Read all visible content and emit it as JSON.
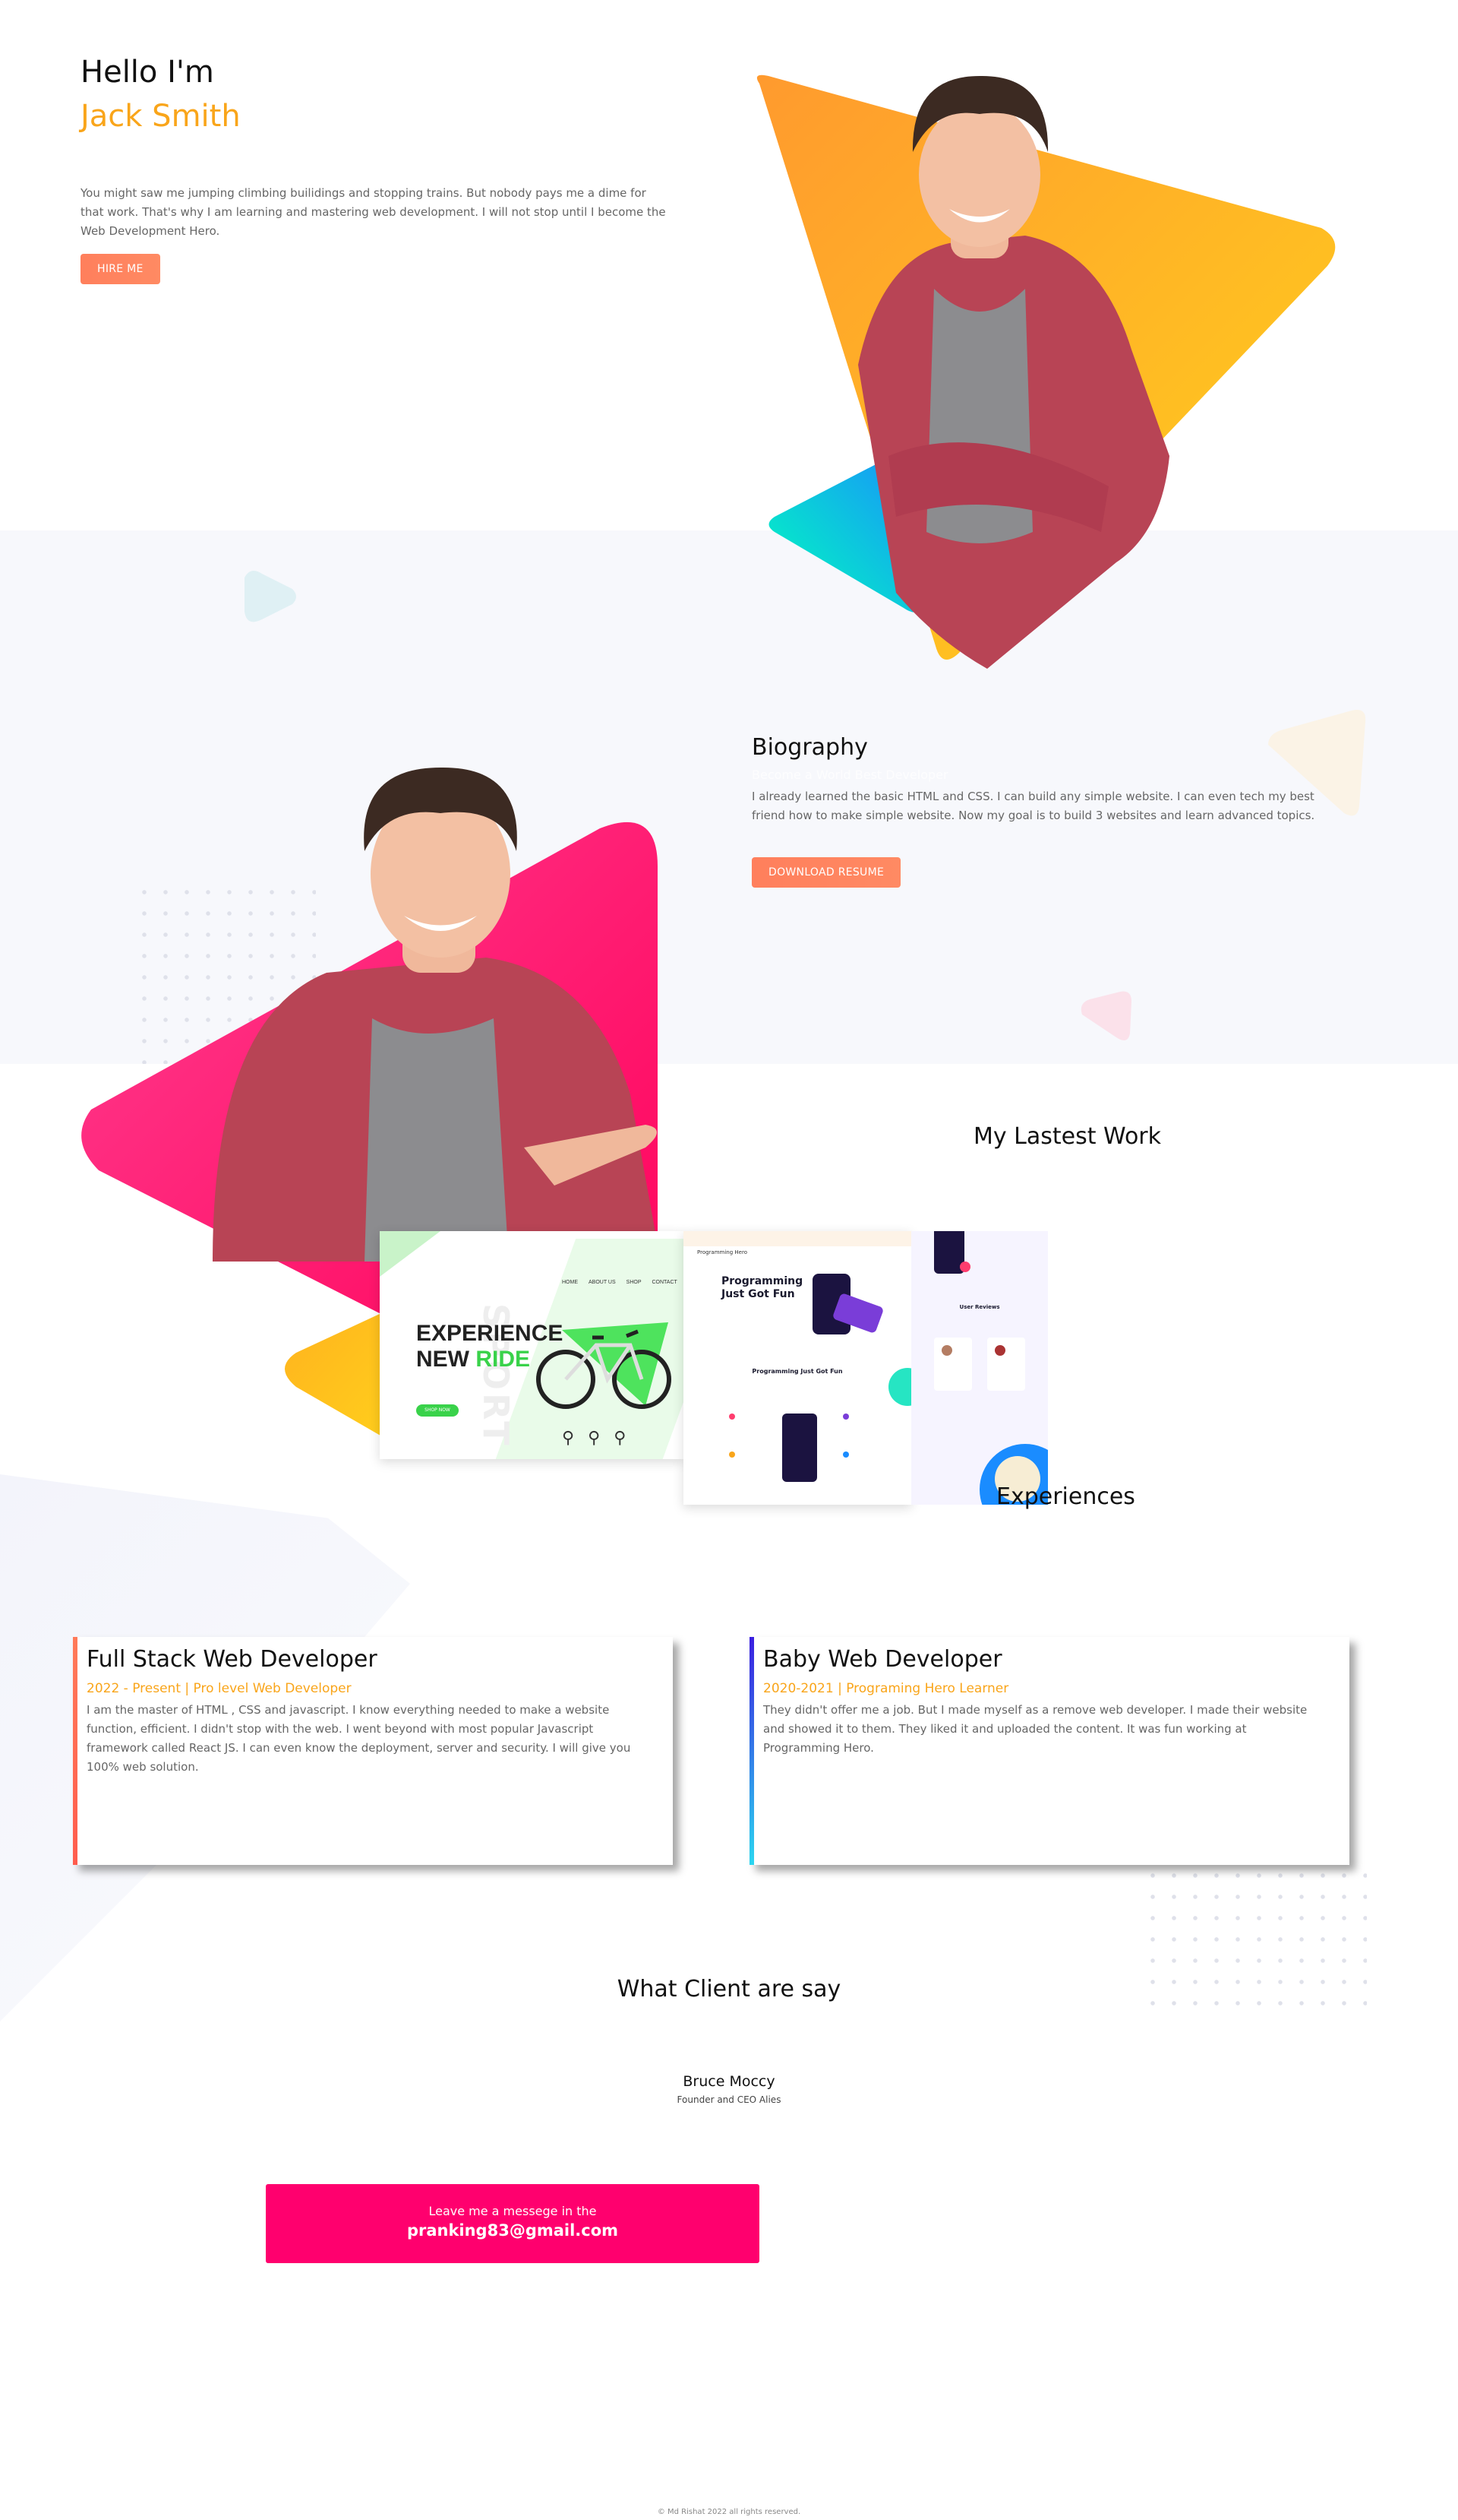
{
  "hero": {
    "greeting": "Hello I'm",
    "name": "Jack Smith",
    "intro": "You might saw me jumping climbing builidings and stopping trains. But nobody pays me a dime for that work. That's why I am learning and mastering web development. I will not stop until I become the Web Development Hero.",
    "hire_button": "HIRE ME"
  },
  "biography": {
    "title": "Biography",
    "subtitle": "Become a World Best Developer",
    "text": "I already learned the basic HTML and CSS. I can build any simple website. I can even tech my best friend how to make simple website. Now my goal is to build 3 websites and learn advanced topics.",
    "download_button": "DOWNLOAD RESUME"
  },
  "latest_work": {
    "title": "My Lastest Work",
    "preview1": {
      "headline1": "EXPERIENCE",
      "headline2": "NEW",
      "headline_accent": "RIDE",
      "watermark": "SPORT",
      "nav": [
        "HOME",
        "ABOUT US",
        "SHOP",
        "CONTACT"
      ],
      "cta": "SHOP NOW"
    },
    "preview2": {
      "brand": "Programming Hero",
      "headline": "Programming Just Got Fun",
      "section": "Programming Just Got Fun"
    },
    "preview3": {
      "section": "User Reviews"
    }
  },
  "experiences": {
    "title": "Experiences",
    "items": [
      {
        "title": "Full Stack Web Developer",
        "meta": "2022 - Present | Pro level Web Developer",
        "desc": "I am the master of HTML , CSS and javascript. I know everything needed to make a website function, efficient. I didn't stop with the web. I went beyond with most popular Javascript framework called React JS. I can even know the deployment, server and security. I will give you 100% web solution.",
        "accent": "#ff7a59"
      },
      {
        "title": "Baby Web Developer",
        "meta": "2020-2021 | Programing Hero Learner",
        "desc": "They didn't offer me a job. But I made myself as a remove web developer. I made their website and showed it to them. They liked it and uploaded the content. It was fun working at Programming Hero.",
        "accent": "#3a1fe0"
      }
    ]
  },
  "clients": {
    "title": "What Client are say",
    "name": "Bruce Moccy",
    "role": "Founder and CEO Alies"
  },
  "contact": {
    "line1": "Leave me a messege in the",
    "email": "pranking83@gmail.com"
  },
  "footer": {
    "text": "© Md Rishat 2022 all rights reserved."
  },
  "colors": {
    "orange": "#f9a51a",
    "pink": "#ff006e",
    "coral": "#ff7f5c",
    "teal": "#00f2b4"
  }
}
